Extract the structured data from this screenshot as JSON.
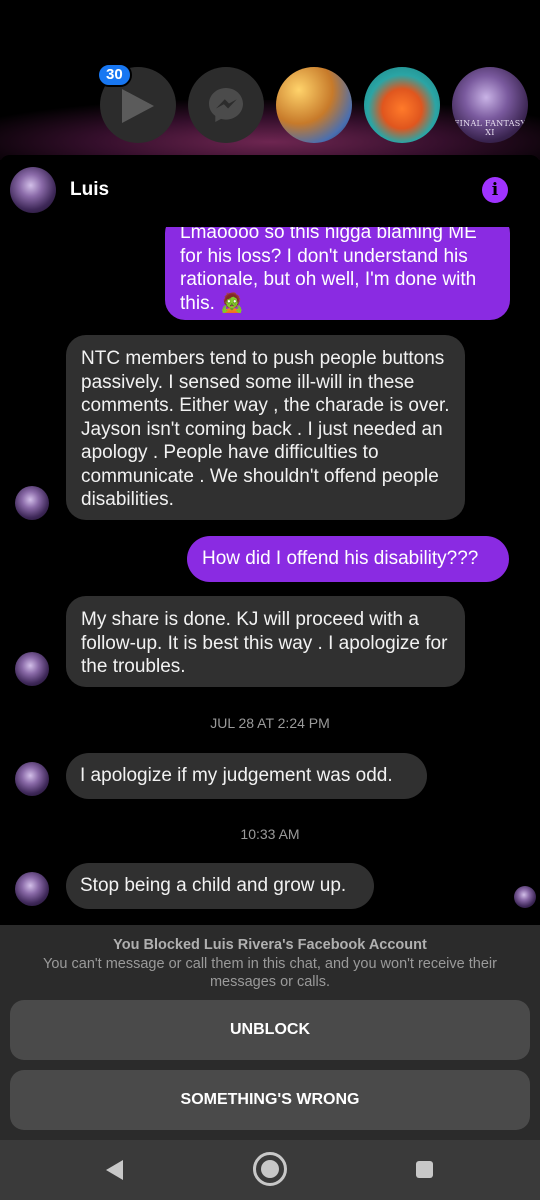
{
  "chat_heads": {
    "badge_count": "30",
    "ff_logo_text": "FINAL FANTASY XI"
  },
  "header": {
    "contact_name": "Luis",
    "info_icon": "i"
  },
  "messages": [
    {
      "dir": "out",
      "text": "Lmaoooo so this nigga blaming ME for his loss?  I don't understand his rationale, but oh well, I'm done with this. 🧟"
    },
    {
      "dir": "in",
      "text": "NTC members tend to push people buttons passively. I sensed some ill-will in these comments.  Either way , the charade is over. Jayson isn't coming back . I just needed an apology . People have difficulties to communicate . We shouldn't offend people disabilities."
    },
    {
      "dir": "out",
      "text": "How did I offend his disability???"
    },
    {
      "dir": "in",
      "text": "My share is done. KJ will proceed with a follow-up. It is best this way . I apologize for the troubles."
    },
    {
      "dir": "in",
      "text": "I apologize if my judgement was odd."
    },
    {
      "dir": "in",
      "text": "Stop being a child and grow up."
    }
  ],
  "timestamps": [
    "JUL 28 AT 2:24 PM",
    "10:33 AM"
  ],
  "blocked": {
    "title": "You Blocked Luis Rivera's Facebook Account",
    "subtitle": "You can't message or call them in this chat, and you won't receive their messages or calls.",
    "unblock_label": "UNBLOCK",
    "wrong_label": "SOMETHING'S WRONG"
  },
  "colors": {
    "accent": "#8a2be2",
    "info": "#a033ff",
    "badge": "#1877f2",
    "incoming_bubble": "#303030"
  }
}
